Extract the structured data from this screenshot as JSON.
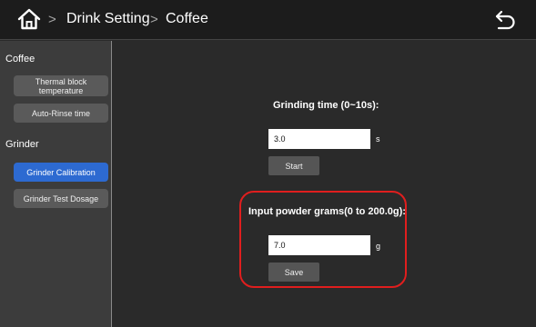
{
  "header": {
    "breadcrumb": [
      "Drink Setting",
      "Coffee"
    ],
    "separator": ">",
    "home_icon": "home-icon",
    "back_icon": "back-arrow-icon"
  },
  "sidebar": {
    "sections": [
      {
        "heading": "Coffee",
        "items": [
          {
            "label": "Thermal block temperature",
            "active": false
          },
          {
            "label": "Auto-Rinse time",
            "active": false
          }
        ]
      },
      {
        "heading": "Grinder",
        "items": [
          {
            "label": "Grinder Calibration",
            "active": true
          },
          {
            "label": "Grinder Test Dosage",
            "active": false
          }
        ]
      }
    ]
  },
  "main": {
    "grinding": {
      "label": "Grinding time (0~10s):",
      "value": "3.0",
      "unit": "s",
      "button": "Start"
    },
    "powder": {
      "label": "Input powder grams(0 to 200.0g):",
      "value": "7.0",
      "unit": "g",
      "button": "Save"
    }
  },
  "colors": {
    "background": "#2a2a2a",
    "topbar": "#1c1c1c",
    "sidebar": "#3c3c3c",
    "active_item": "#2d6ad1",
    "highlight_outline": "#e01e1e"
  }
}
